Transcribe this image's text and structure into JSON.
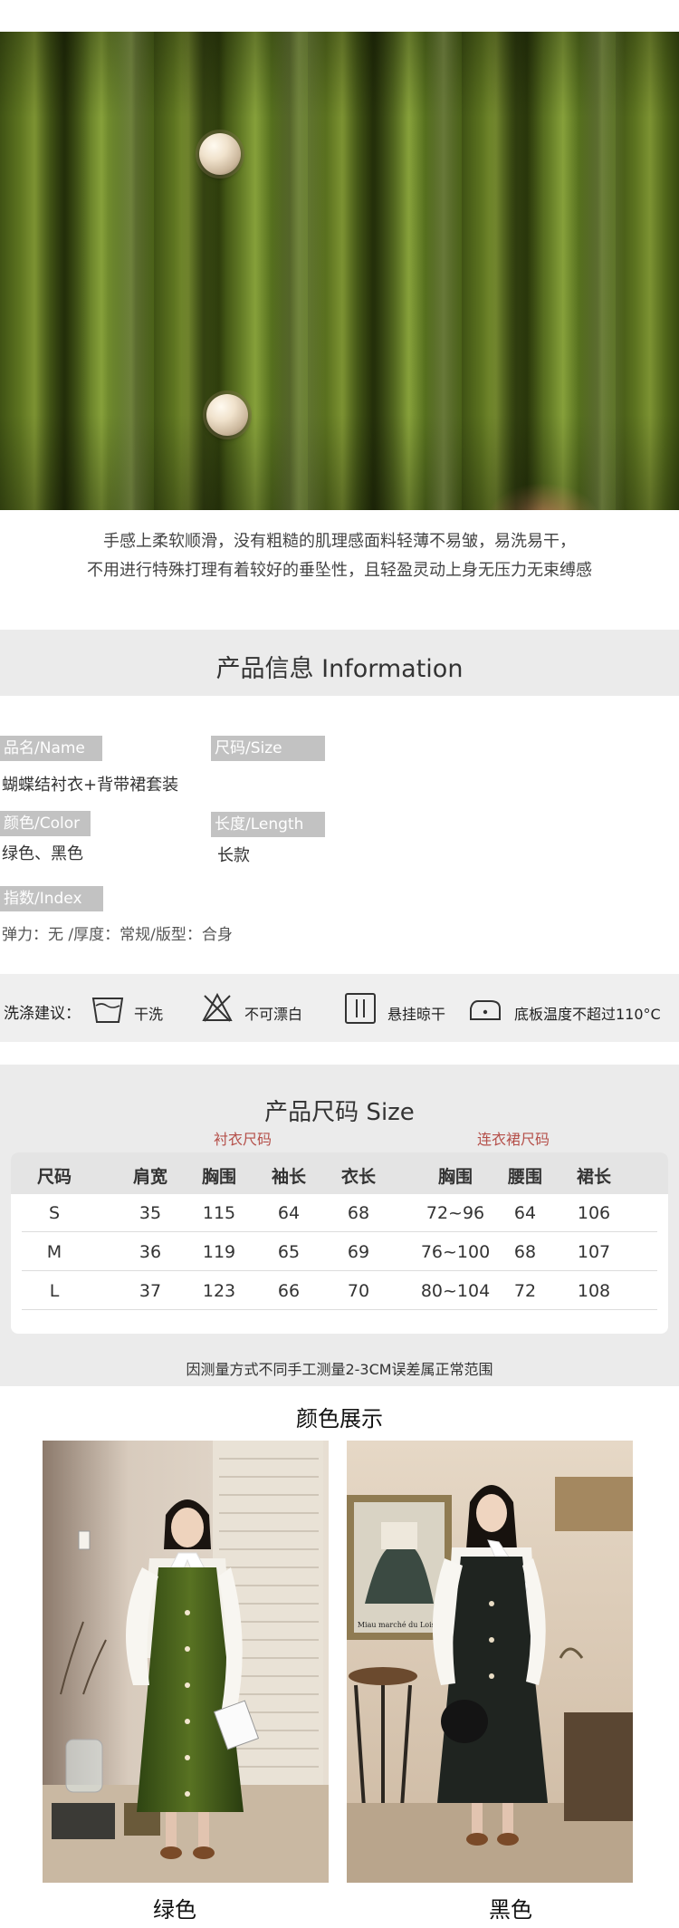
{
  "hero": {
    "caption_lines": [
      "手感上柔软顺滑，没有粗糙的肌理感面料轻薄不易皱，易洗易干，",
      "不用进行特殊打理有着较好的垂坠性，且轻盈灵动上身无压力无束缚感"
    ]
  },
  "product_info": {
    "title": "产品信息 Information",
    "name_tag": "品名/Name",
    "name_value": "蝴蝶结衬衣+背带裙套装",
    "size_tag": "尺码/Size",
    "color_tag": "颜色/Color",
    "color_value": "绿色、黑色",
    "length_tag": "长度/Length",
    "length_value": "长款",
    "index_tag": "指数/Index",
    "index_value": "弹力：无 /厚度：常规/版型：合身"
  },
  "care": {
    "label": "洗涤建议：",
    "items": [
      {
        "icon": "dry-clean-icon",
        "text": "干洗"
      },
      {
        "icon": "no-bleach-icon",
        "text": "不可漂白"
      },
      {
        "icon": "hang-dry-icon",
        "text": "悬挂晾干"
      },
      {
        "icon": "iron-icon",
        "text": "底板温度不超过110°C"
      }
    ]
  },
  "size_chart": {
    "title": "产品尺码 Size",
    "shirt_label": "衬衣尺码",
    "dress_label": "连衣裙尺码",
    "headers": [
      "尺码",
      "肩宽",
      "胸围",
      "袖长",
      "衣长",
      "胸围",
      "腰围",
      "裙长"
    ],
    "rows": [
      [
        "S",
        "35",
        "115",
        "64",
        "68",
        "72~96",
        "64",
        "106"
      ],
      [
        "M",
        "36",
        "119",
        "65",
        "69",
        "76~100",
        "68",
        "107"
      ],
      [
        "L",
        "37",
        "123",
        "66",
        "70",
        "80~104",
        "72",
        "108"
      ]
    ],
    "note": "因测量方式不同手工测量2-3CM误差属正常范围"
  },
  "colors": {
    "title": "颜色展示",
    "green_label": "绿色",
    "black_label": "黑色",
    "poster_text": "Miau marché du Loisir"
  },
  "palette": {
    "velvet_green": "#5d7420",
    "velvet_black": "#1f2420",
    "band_gray": "#ebebeb",
    "tag_gray": "#c2c2c2",
    "subhead_red": "#b5504a"
  }
}
